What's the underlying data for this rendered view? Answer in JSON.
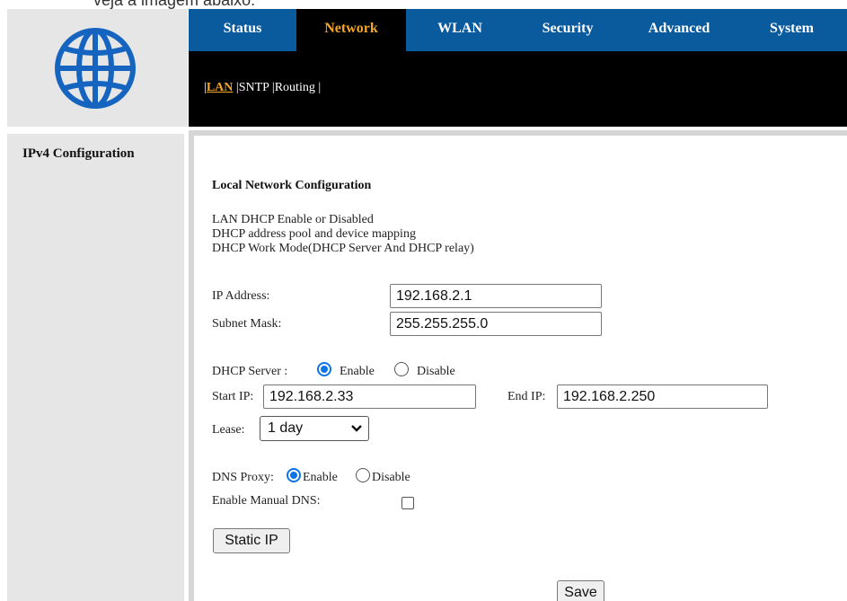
{
  "caption": "veja a imagem abaixo:",
  "nav": {
    "menu": [
      "Status",
      "Network",
      "WLAN",
      "Security",
      "Advanced",
      "System"
    ],
    "active": "Network",
    "submenu_prefix": "|",
    "submenu": [
      "LAN",
      "SNTP",
      "Routing"
    ],
    "submenu_sep": "|",
    "submenu_active": "LAN"
  },
  "sidebar": {
    "items": [
      "IPv4 Configuration"
    ]
  },
  "main": {
    "title": "Local Network Configuration",
    "desc": [
      "LAN DHCP Enable or Disabled",
      "DHCP address pool and device mapping",
      "DHCP Work Mode(DHCP Server And DHCP relay)"
    ],
    "ip_label": "IP Address:",
    "ip_value": "192.168.2.1",
    "mask_label": "Subnet Mask:",
    "mask_value": "255.255.255.0",
    "dhcp_label": "DHCP Server :",
    "dhcp_enable": "Enable",
    "dhcp_disable": "Disable",
    "dhcp_selected": "Enable",
    "start_label": "Start IP:",
    "start_value": "192.168.2.33",
    "end_label": "End IP:",
    "end_value": "192.168.2.250",
    "lease_label": "Lease:",
    "lease_value": "1 day",
    "dns_proxy_label": "DNS Proxy:",
    "dns_enable": "Enable",
    "dns_disable": "Disable",
    "dns_selected": "Enable",
    "manual_dns_label": "Enable Manual DNS:",
    "manual_dns_checked": false,
    "static_ip_button": "Static IP",
    "save_button": "Save"
  },
  "colors": {
    "menu_bg": "#0a5a9e",
    "active_text": "#f5a623",
    "radio_accent": "#0b74e8"
  },
  "icons": {
    "logo": "globe-icon",
    "lease_dropdown": "chevron-down-icon"
  }
}
